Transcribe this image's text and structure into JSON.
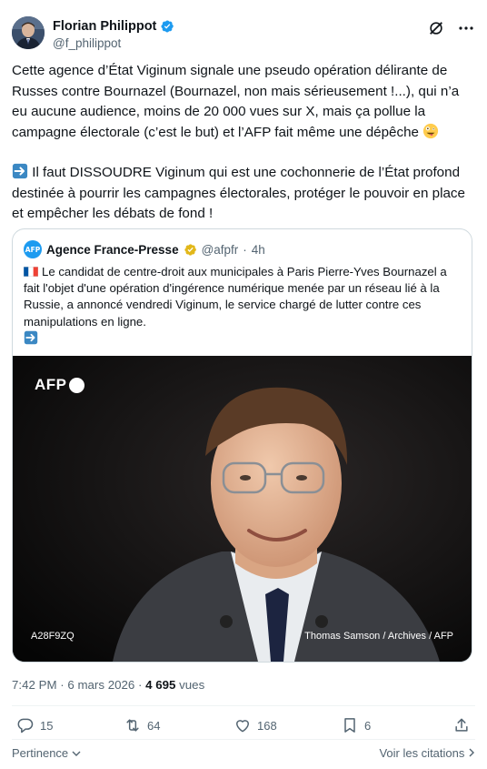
{
  "author": {
    "display_name": "Florian Philippot",
    "handle": "@f_philippot"
  },
  "tweet": {
    "paragraph1": "Cette agence d’État Viginum signale une pseudo opération délirante de Russes contre Bournazel (Bournazel, non mais sérieusement !...), qui n’a eu aucune audience, moins de 20 000 vues sur X, mais ça pollue la campagne électorale (c’est le but) et l’AFP fait même une dépêche",
    "paragraph2": "Il faut DISSOUDRE Viginum qui est une cochonnerie de l’État profond destinée à pourrir les campagnes électorales, protéger le pouvoir en place et empêcher les débats de fond !",
    "emoji1": "zany-face-emoji",
    "emoji2": "right-arrow-emoji"
  },
  "quote": {
    "avatar_text": "AFP",
    "name": "Agence France-Presse",
    "handle": "@afpfr",
    "separator": "·",
    "time": "4h",
    "text": "Le candidat de centre-droit aux municipales à Paris Pierre-Yves Bournazel a fait l'objet d'une opération d'ingérence numérique menée par un réseau lié à la Russie, a annoncé vendredi Viginum, le service chargé de lutter contre ces manipulations en ligne.",
    "media": {
      "logo_text": "AFP",
      "code": "A28F9ZQ",
      "credit": "Thomas Samson / Archives / AFP"
    }
  },
  "meta": {
    "time": "7:42 PM",
    "separator": "·",
    "date": "6 mars 2026",
    "separator2": "·",
    "views_count": "4 695",
    "views_label": "vues"
  },
  "actions": {
    "replies": "15",
    "reposts": "64",
    "likes": "168",
    "bookmarks": "6"
  },
  "footer": {
    "left_label": "Pertinence",
    "right_label": "Voir les citations"
  },
  "colors": {
    "verified_blue": "#1d9bf0",
    "gold_badge": "#e2b719",
    "secondary_text": "#536471",
    "border": "#cfd9de"
  }
}
